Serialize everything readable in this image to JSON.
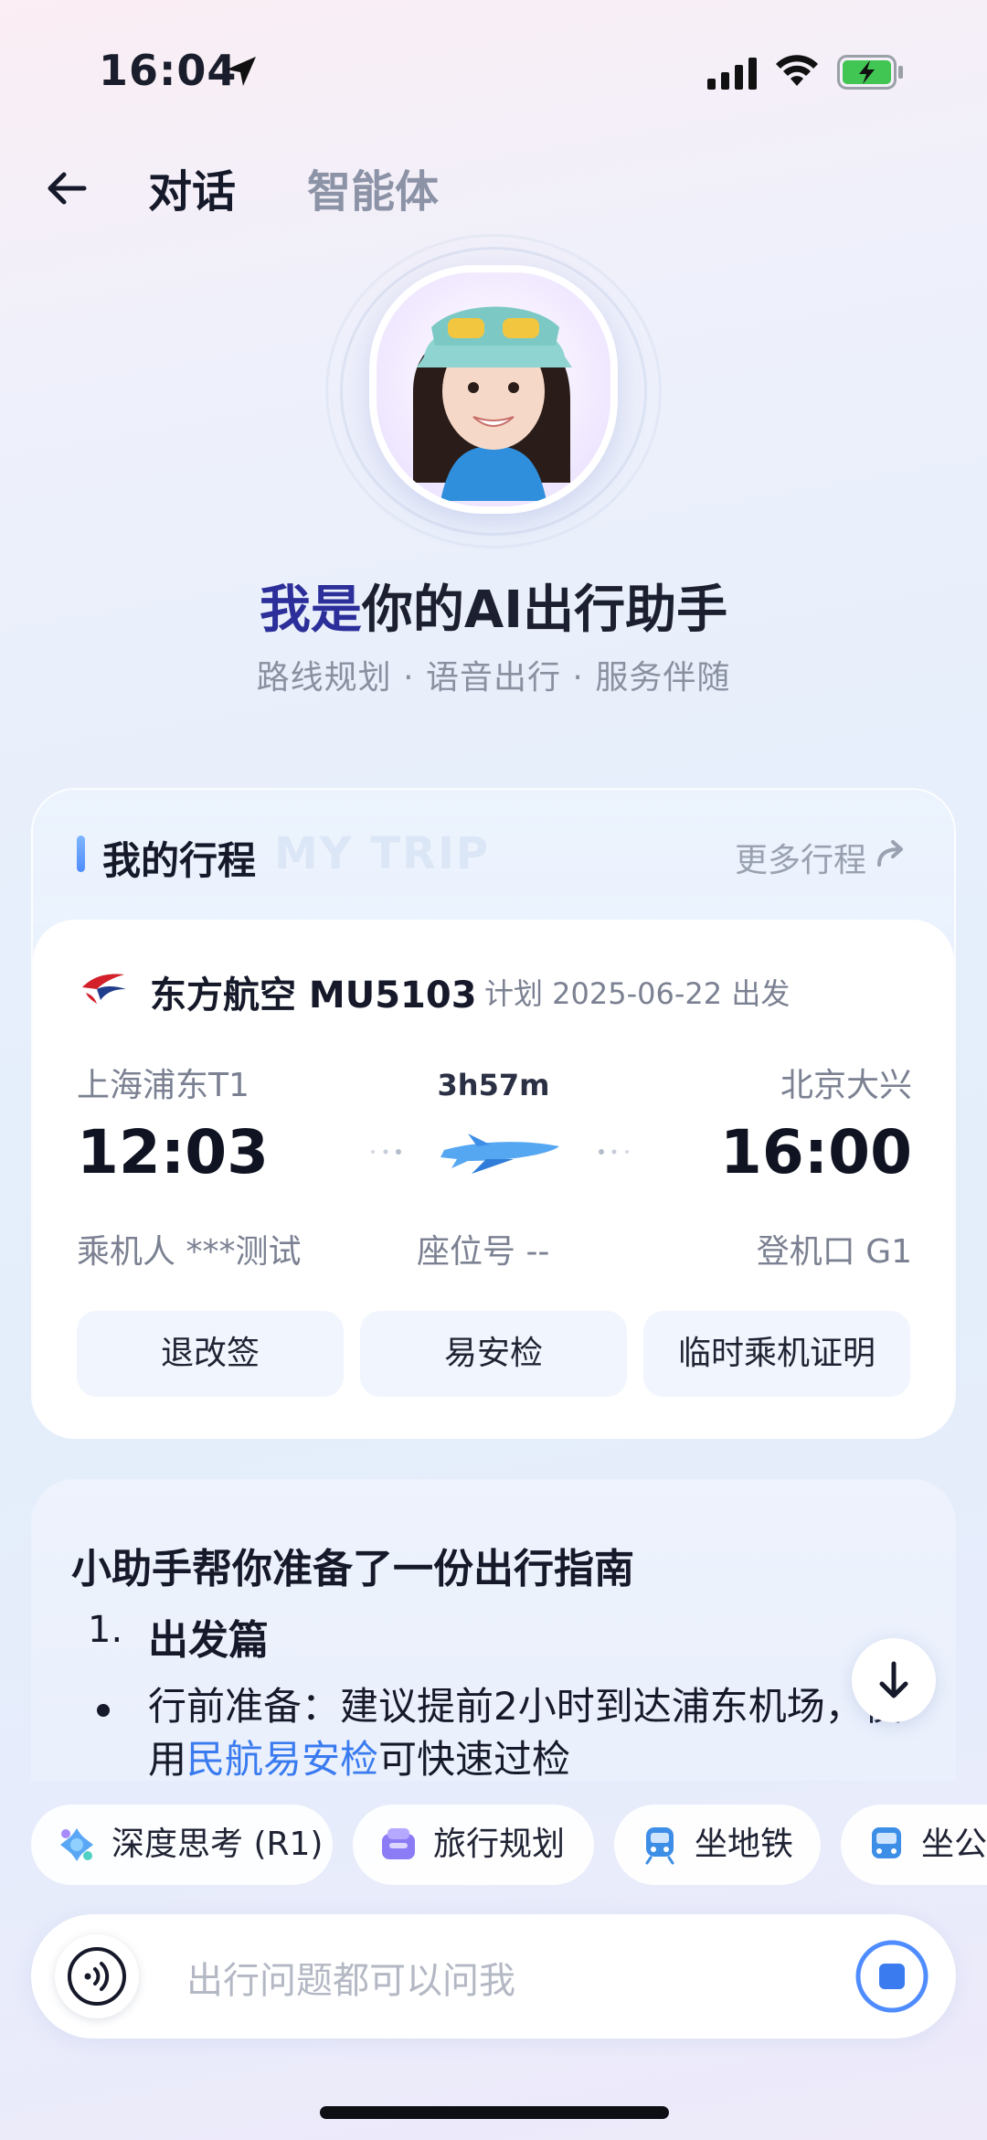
{
  "status": {
    "time": "16:04"
  },
  "header": {
    "tab_active": "对话",
    "tab_inactive": "智能体"
  },
  "hero": {
    "title_highlight": "我是",
    "title_rest": "你的AI出行助手",
    "subtitle": "路线规划 · 语音出行 · 服务伴随"
  },
  "trip": {
    "section_title": "我的行程",
    "watermark": "MY TRIP",
    "more_label": "更多行程",
    "airline": "东方航空 MU5103",
    "plan": "计划  2025-06-22 出发",
    "dep_city": "上海浦东T1",
    "arr_city": "北京大兴",
    "duration": "3h57m",
    "dep_time": "12:03",
    "arr_time": "16:00",
    "passenger": "乘机人 ***测试",
    "seat": "座位号 --",
    "gate": "登机口 G1",
    "actions": [
      "退改签",
      "易安检",
      "临时乘机证明"
    ]
  },
  "guide": {
    "title": "小助手帮你准备了一份出行指南",
    "item_num": "1.",
    "item_heading": "出发篇",
    "text_before": "行前准备：建议提前2小时到达浦东机场，使用",
    "text_link": "民航易安检",
    "text_after": "可快速过检"
  },
  "chips": [
    "深度思考 (R1)",
    "旅行规划",
    "坐地铁",
    "坐公交"
  ],
  "input": {
    "placeholder": "出行问题都可以问我"
  },
  "colors": {
    "accent": "#3a7bf0",
    "title_highlight": "#2c2f9a",
    "muted": "#7b8192"
  }
}
